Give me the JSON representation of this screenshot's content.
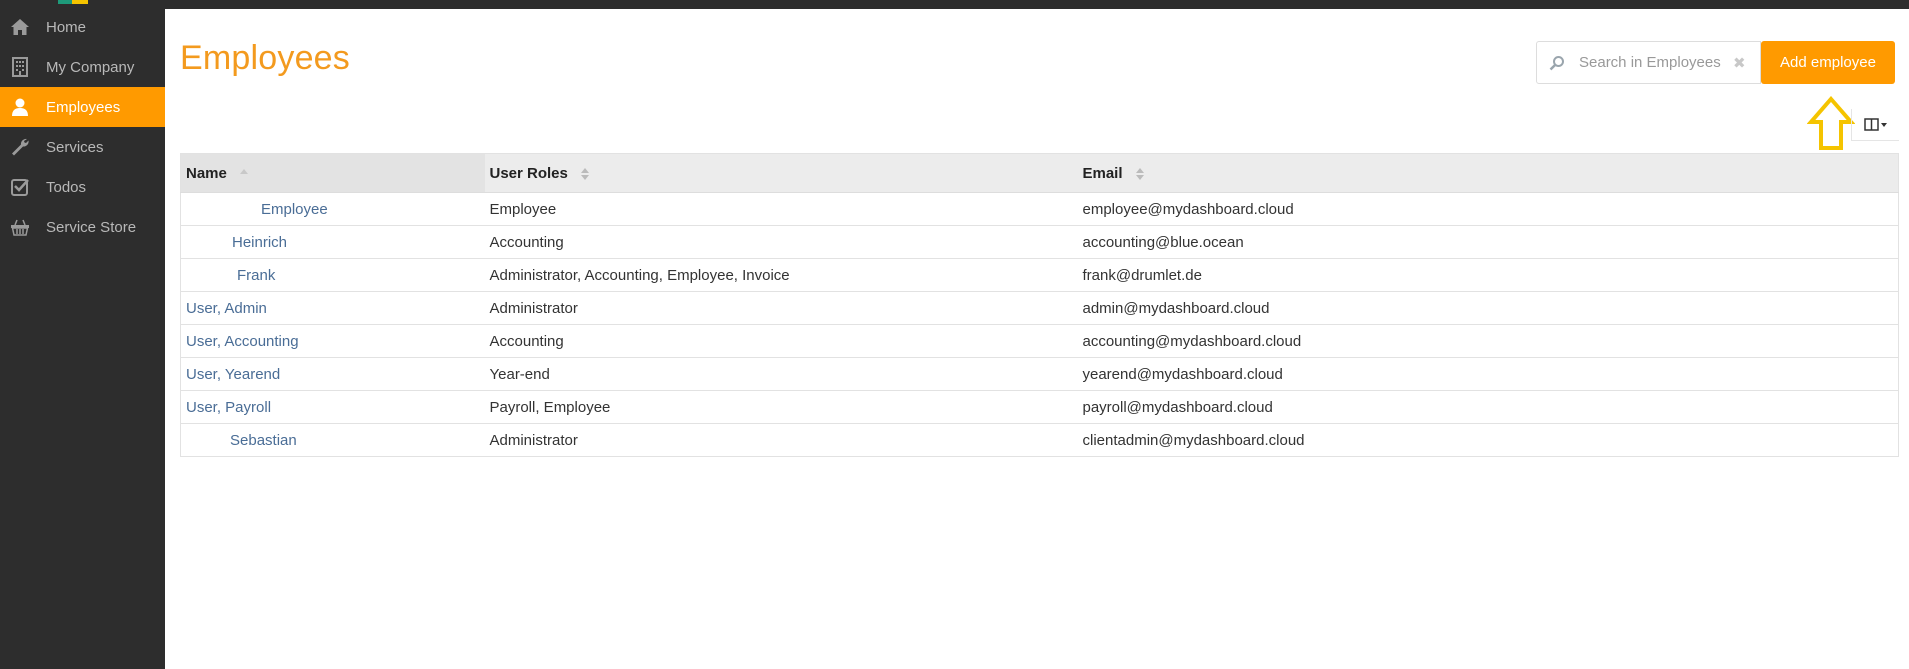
{
  "sidebar": {
    "items": [
      {
        "label": "Home",
        "icon": "home-icon",
        "active": false
      },
      {
        "label": "My Company",
        "icon": "building-icon",
        "active": false
      },
      {
        "label": "Employees",
        "icon": "user-icon",
        "active": true
      },
      {
        "label": "Services",
        "icon": "wrench-icon",
        "active": false
      },
      {
        "label": "Todos",
        "icon": "checkbox-icon",
        "active": false
      },
      {
        "label": "Service Store",
        "icon": "basket-icon",
        "active": false
      }
    ]
  },
  "colors": {
    "accent": "#ff9a00",
    "title": "#f39a1e",
    "sidebar_bg": "#2d2d2d",
    "link": "#4a6d96",
    "highlight_arrow": "#f5c400"
  },
  "header": {
    "title": "Employees",
    "search_placeholder": "Search in Employees",
    "search_value": "",
    "clear_label": "✖",
    "add_button": "Add employee"
  },
  "table": {
    "columns": [
      {
        "label": "Name",
        "sort": "ascending"
      },
      {
        "label": "User Roles",
        "sort": "none"
      },
      {
        "label": "Email",
        "sort": "none"
      }
    ],
    "rows": [
      {
        "name": "Employee",
        "roles": "Employee",
        "email": "employee@mydashboard.cloud"
      },
      {
        "name": "Heinrich",
        "roles": "Accounting",
        "email": "accounting@blue.ocean"
      },
      {
        "name": "Frank",
        "roles": "Administrator, Accounting, Employee, Invoice",
        "email": "frank@drumlet.de"
      },
      {
        "name": "User, Admin",
        "roles": "Administrator",
        "email": "admin@mydashboard.cloud"
      },
      {
        "name": "User, Accounting",
        "roles": "Accounting",
        "email": "accounting@mydashboard.cloud"
      },
      {
        "name": "User, Yearend",
        "roles": "Year-end",
        "email": "yearend@mydashboard.cloud"
      },
      {
        "name": "User, Payroll",
        "roles": "Payroll, Employee",
        "email": "payroll@mydashboard.cloud"
      },
      {
        "name": "Sebastian",
        "roles": "Administrator",
        "email": "clientadmin@mydashboard.cloud"
      }
    ]
  }
}
